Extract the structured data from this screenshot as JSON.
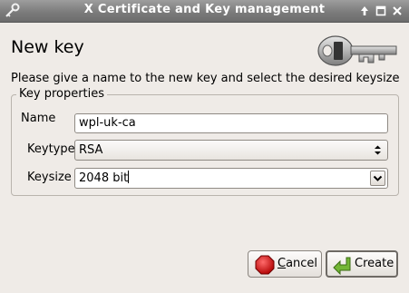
{
  "window": {
    "title": "X Certificate and Key management",
    "controls": [
      "window-shade-icon",
      "maximize-icon",
      "close-icon"
    ]
  },
  "dialog": {
    "heading": "New key",
    "instruction": "Please give a name to the new key and select the desired keysize"
  },
  "key_properties": {
    "group_title": "Key properties",
    "name_label": "Name",
    "name_value": "wpl-uk-ca",
    "keytype_label": "Keytype",
    "keytype_value": "RSA",
    "keysize_label": "Keysize",
    "keysize_value": "2048 bit"
  },
  "buttons": {
    "cancel_first": "C",
    "cancel_rest": "ancel",
    "create": "Create"
  },
  "colors": {
    "background": "#efebe7",
    "titlebar": "#7c7c7c",
    "cancel_icon": "#d40000",
    "create_icon": "#4e9a06"
  }
}
